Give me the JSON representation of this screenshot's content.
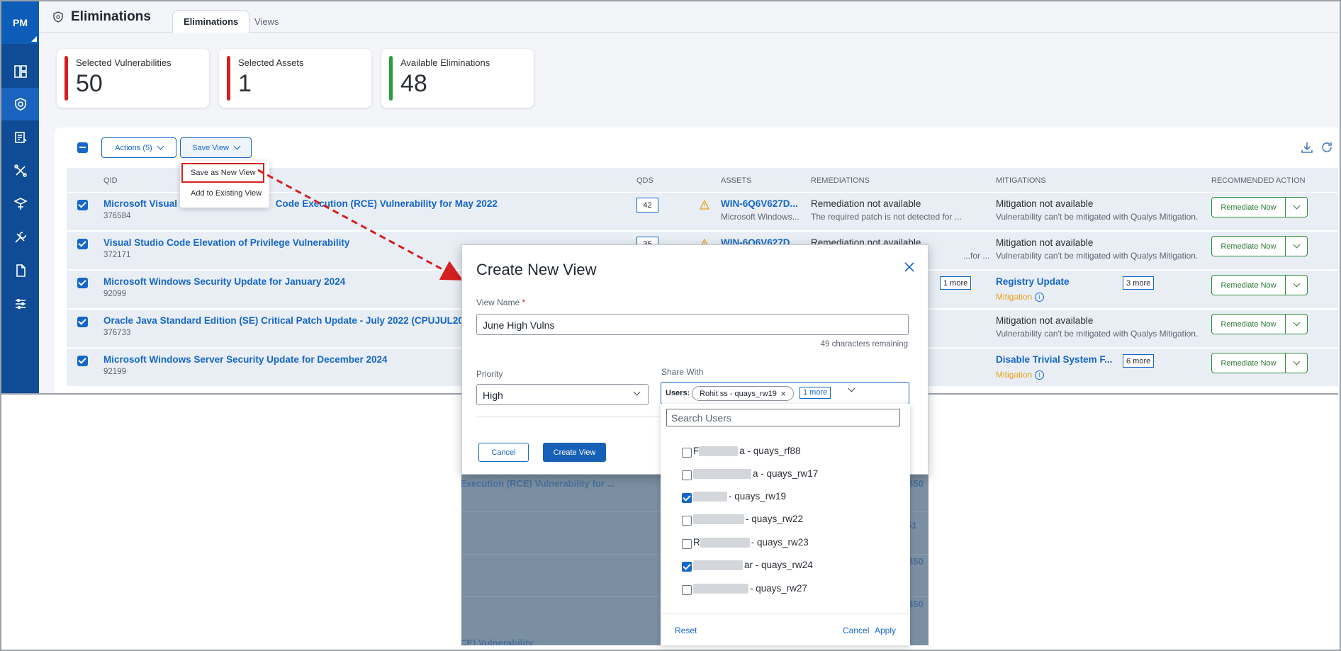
{
  "nav": {
    "badge": "PM",
    "icons": [
      "dashboard-icon",
      "shield-icon",
      "patch-icon",
      "tools-icon",
      "deploy-icon",
      "wrench-icon",
      "document-icon",
      "settings-sliders-icon"
    ]
  },
  "header": {
    "title": "Eliminations",
    "tabs": [
      {
        "label": "Eliminations"
      },
      {
        "label": "Views"
      }
    ]
  },
  "cards": [
    {
      "label": "Selected Vulnerabilities",
      "value": "50",
      "color": "#d42020"
    },
    {
      "label": "Selected Assets",
      "value": "1",
      "color": "#d42020"
    },
    {
      "label": "Available Eliminations",
      "value": "48",
      "color": "#2e9a3f"
    }
  ],
  "toolbar": {
    "actions_label": "Actions (5)",
    "save_view_label": "Save View"
  },
  "save_menu": {
    "items": [
      "Save as New View",
      "Add to Existing View"
    ]
  },
  "table": {
    "headers": {
      "qid": "QID",
      "qds": "QDS",
      "assets": "ASSETS",
      "remediations": "REMEDIATIONS",
      "mitigations": "MITIGATIONS",
      "action": "RECOMMENDED ACTION"
    },
    "rows": [
      {
        "title": "Microsoft Visual S",
        "title_rest": "Code Execution (RCE) Vulnerability for May 2022",
        "qid": "376584",
        "qds": "42",
        "asset": "WIN-6Q6V627D...",
        "asset_sub": "Microsoft Windows...",
        "remediation": "Remediation not available",
        "remediation_sub": "The required patch is not detected for ...",
        "mitigation": "Mitigation not available",
        "mitigation_sub": "Vulnerability can't be mitigated with Qualys Mitigation.",
        "action": "Remediate Now"
      },
      {
        "title": "Visual Studio Code Elevation of Privilege Vulnerability",
        "qid": "372171",
        "qds": "35",
        "asset": "WIN-6Q6V627D...",
        "remediation": "Remediation not available",
        "remediation_sub": "...for ...",
        "mitigation": "Mitigation not available",
        "mitigation_sub": "Vulnerability can't be mitigated with Qualys Mitigation.",
        "action": "Remediate Now"
      },
      {
        "title": "Microsoft Windows Security Update for January 2024",
        "qid": "92099",
        "rem_more": "1 more",
        "mitigation": "Registry Update",
        "mit_more": "3 more",
        "mitigation_tag": "Mitigation",
        "action": "Remediate Now"
      },
      {
        "title": "Oracle Java Standard Edition (SE) Critical Patch Update - July 2022 (CPUJUL2022)",
        "qid": "376733",
        "mitigation": "Mitigation not available",
        "mitigation_sub": "Vulnerability can't be mitigated with Qualys Mitigation.",
        "action": "Remediate Now"
      },
      {
        "title": "Microsoft Windows Server Security Update for December 2024",
        "qid": "92199",
        "mitigation": "Disable Trivial System F...",
        "mit_more": "6 more",
        "mitigation_tag": "Mitigation",
        "action": "Remediate Now"
      }
    ]
  },
  "underlay": {
    "ghost_1": "Execution (RCE) Vulnerability for ...",
    "ghost_2": "CE) Vulnerability",
    "kb_1": "B50",
    "kb_2": "51",
    "kb_3": "B50",
    "kb_4": "B50"
  },
  "dialog": {
    "title": "Create New View",
    "view_name_label": "View Name",
    "required_mark": "*",
    "view_name_value": "June High Vulns",
    "counter": "49 characters remaining",
    "priority_label": "Priority",
    "priority_value": "High",
    "share_label": "Share With",
    "users_label": "Users:",
    "chip": "Rohit ss - quays_rw19",
    "one_more": "1 more",
    "cancel": "Cancel",
    "create": "Create View"
  },
  "user_panel": {
    "search_placeholder": "Search Users",
    "users": [
      {
        "prefix": "F",
        "suffix": "a - quays_rf88",
        "checked": false
      },
      {
        "prefix": "",
        "suffix": "a - quays_rw17",
        "checked": false
      },
      {
        "prefix": "",
        "suffix": "- quays_rw19",
        "checked": true
      },
      {
        "prefix": "",
        "suffix": "- quays_rw22",
        "checked": false
      },
      {
        "prefix": "R",
        "suffix": "- quays_rw23",
        "checked": false
      },
      {
        "prefix": "",
        "suffix": "ar - quays_rw24",
        "checked": true
      },
      {
        "prefix": "",
        "suffix": "- quays_rw27",
        "checked": false
      }
    ],
    "reset": "Reset",
    "cancel": "Cancel",
    "apply": "Apply"
  }
}
